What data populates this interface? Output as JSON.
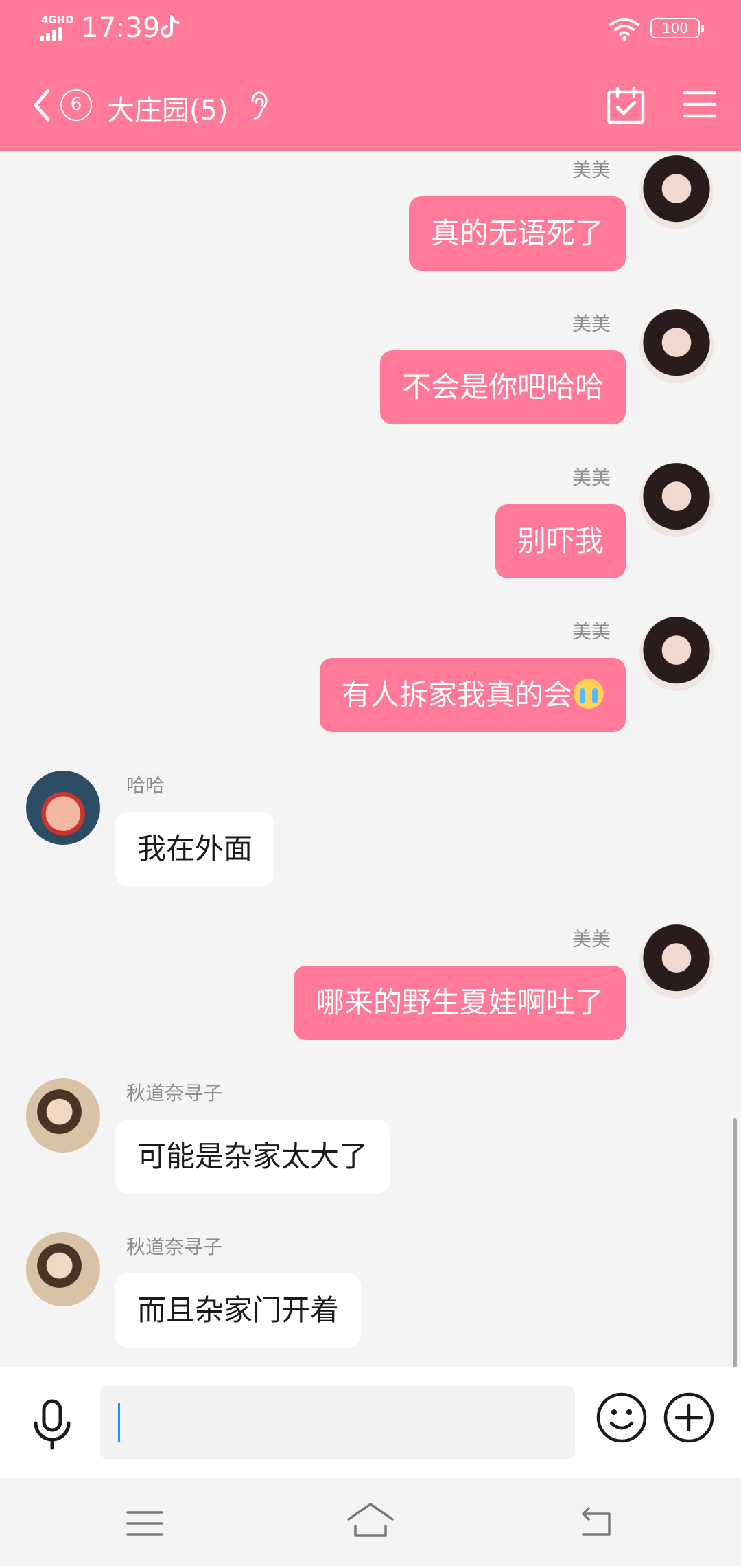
{
  "colors": {
    "accent": "#fe7a98",
    "background": "#f4f4f4",
    "incoming_bubble": "#ffffff"
  },
  "status_bar": {
    "network_type": "4GHD",
    "time": "17:39",
    "battery": "100",
    "icons": [
      "signal-icon",
      "tiktok-icon",
      "wifi-icon",
      "battery-icon"
    ]
  },
  "header": {
    "unread_count": "6",
    "title": "大庄园(5)",
    "icons": [
      "back-icon",
      "ear-icon",
      "calendar-check-icon",
      "menu-icon"
    ]
  },
  "messages": [
    {
      "sender": "美美",
      "direction": "out",
      "text": "真的无语死了"
    },
    {
      "sender": "美美",
      "direction": "out",
      "text": "不会是你吧哈哈"
    },
    {
      "sender": "美美",
      "direction": "out",
      "text": "别吓我"
    },
    {
      "sender": "美美",
      "direction": "out",
      "text": "有人拆家我真的会",
      "emoji": "crying-emoji"
    },
    {
      "sender": "哈哈",
      "direction": "in",
      "text": "我在外面"
    },
    {
      "sender": "美美",
      "direction": "out",
      "text": "哪来的野生夏娃啊吐了"
    },
    {
      "sender": "秋道奈寻子",
      "direction": "in",
      "text": "可能是杂家太大了"
    },
    {
      "sender": "秋道奈寻子",
      "direction": "in",
      "text": "而且杂家门开着"
    }
  ],
  "input": {
    "value": "",
    "icons": [
      "microphone-icon",
      "smiley-icon",
      "plus-circle-icon"
    ]
  },
  "system_nav": {
    "icons": [
      "menu-lines-icon",
      "home-icon",
      "back-arrow-icon"
    ]
  }
}
